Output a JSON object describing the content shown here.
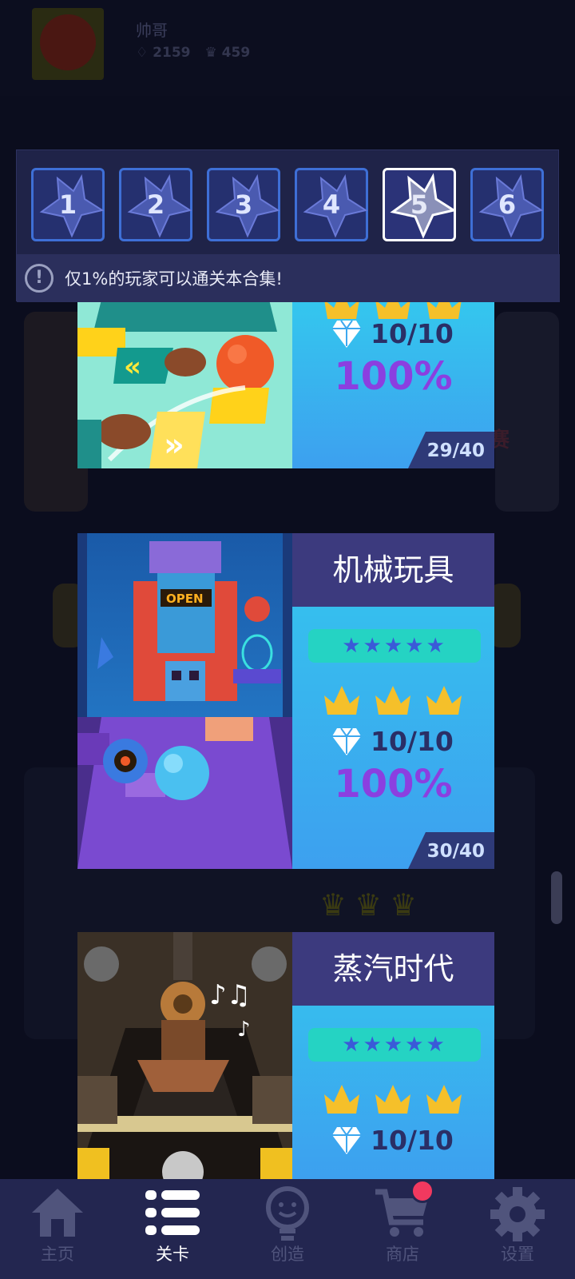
{
  "profile": {
    "name": "帅哥",
    "gems": "2159",
    "crowns": "459"
  },
  "background_text": {
    "side_label": "赛"
  },
  "chapters": {
    "tabs": [
      "1",
      "2",
      "3",
      "4",
      "5",
      "6"
    ],
    "active_index": 4,
    "notice": "仅1%的玩家可以通关本合集!"
  },
  "levels": [
    {
      "title": "",
      "gems": "10/10",
      "percent": "100%",
      "count": "29/40"
    },
    {
      "title": "机械玩具",
      "stars": "★★★★★",
      "gems": "10/10",
      "percent": "100%",
      "count": "30/40"
    },
    {
      "title": "蒸汽时代",
      "stars": "★★★★★",
      "gems": "10/10"
    }
  ],
  "nav": {
    "items": [
      "主页",
      "关卡",
      "创造",
      "商店",
      "设置"
    ],
    "active_index": 1
  },
  "colors": {
    "accent": "#3e6fd6",
    "panel": "#1f2348",
    "nav": "#232650",
    "percent": "#8b3fe0",
    "badge": "#f2395f"
  }
}
